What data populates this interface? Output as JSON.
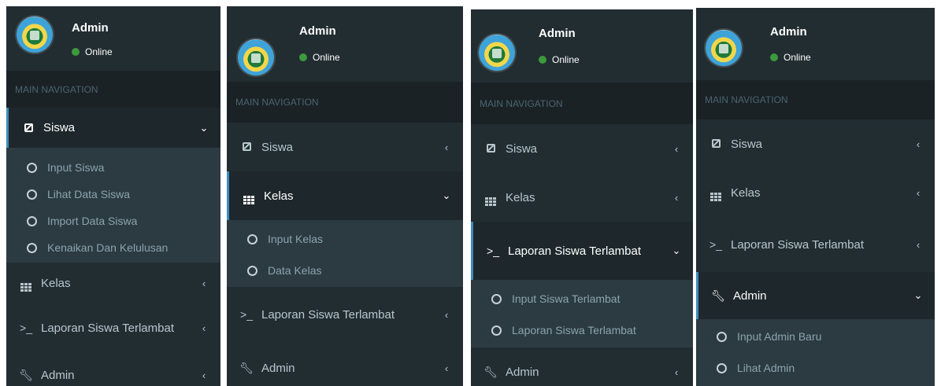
{
  "panels": [
    {
      "user": {
        "name": "Admin",
        "status": "Online"
      },
      "header": "MAIN NAVIGATION",
      "items": [
        {
          "icon": "edit-icon",
          "label": "Siswa",
          "chevron": "⌄",
          "active": true,
          "submenu": [
            "Input Siswa",
            "Lihat Data Siswa",
            "Import Data Siswa",
            "Kenaikan Dan Kelulusan"
          ]
        },
        {
          "icon": "grid-icon",
          "label": "Kelas",
          "chevron": "‹"
        },
        {
          "icon": "terminal-icon",
          "label": "Laporan Siswa Terlambat",
          "chevron": "‹"
        },
        {
          "icon": "wrench-icon",
          "label": "Admin",
          "chevron": "‹"
        }
      ]
    },
    {
      "user": {
        "name": "Admin",
        "status": "Online"
      },
      "header": "MAIN NAVIGATION",
      "items": [
        {
          "icon": "edit-icon",
          "label": "Siswa",
          "chevron": "‹"
        },
        {
          "icon": "grid-icon",
          "label": "Kelas",
          "chevron": "⌄",
          "active": true,
          "submenu": [
            "Input Kelas",
            "Data Kelas"
          ]
        },
        {
          "icon": "terminal-icon",
          "label": "Laporan Siswa Terlambat",
          "chevron": "‹"
        },
        {
          "icon": "wrench-icon",
          "label": "Admin",
          "chevron": "‹"
        }
      ]
    },
    {
      "user": {
        "name": "Admin",
        "status": "Online"
      },
      "header": "MAIN NAVIGATION",
      "items": [
        {
          "icon": "edit-icon",
          "label": "Siswa",
          "chevron": "‹"
        },
        {
          "icon": "grid-icon",
          "label": "Kelas",
          "chevron": "‹"
        },
        {
          "icon": "terminal-icon",
          "label": "Laporan Siswa Terlambat",
          "chevron": "⌄",
          "active": true,
          "submenu": [
            "Input Siswa Terlambat",
            "Laporan Siswa Terlambat"
          ]
        },
        {
          "icon": "wrench-icon",
          "label": "Admin",
          "chevron": "‹"
        }
      ]
    },
    {
      "user": {
        "name": "Admin",
        "status": "Online"
      },
      "header": "MAIN NAVIGATION",
      "items": [
        {
          "icon": "edit-icon",
          "label": "Siswa",
          "chevron": "‹"
        },
        {
          "icon": "grid-icon",
          "label": "Kelas",
          "chevron": "‹"
        },
        {
          "icon": "terminal-icon",
          "label": "Laporan Siswa Terlambat",
          "chevron": "‹"
        },
        {
          "icon": "wrench-icon",
          "label": "Admin",
          "chevron": "⌄",
          "active": true,
          "submenu": [
            "Input Admin Baru",
            "Lihat Admin"
          ]
        }
      ]
    }
  ],
  "colors": {
    "sidebar_bg": "#222d32",
    "header_bg": "#1a2226",
    "submenu_bg": "#2c3b41",
    "active_bg": "#1e282c",
    "accent": "#3c8dbc",
    "online": "#3c9a3c"
  }
}
